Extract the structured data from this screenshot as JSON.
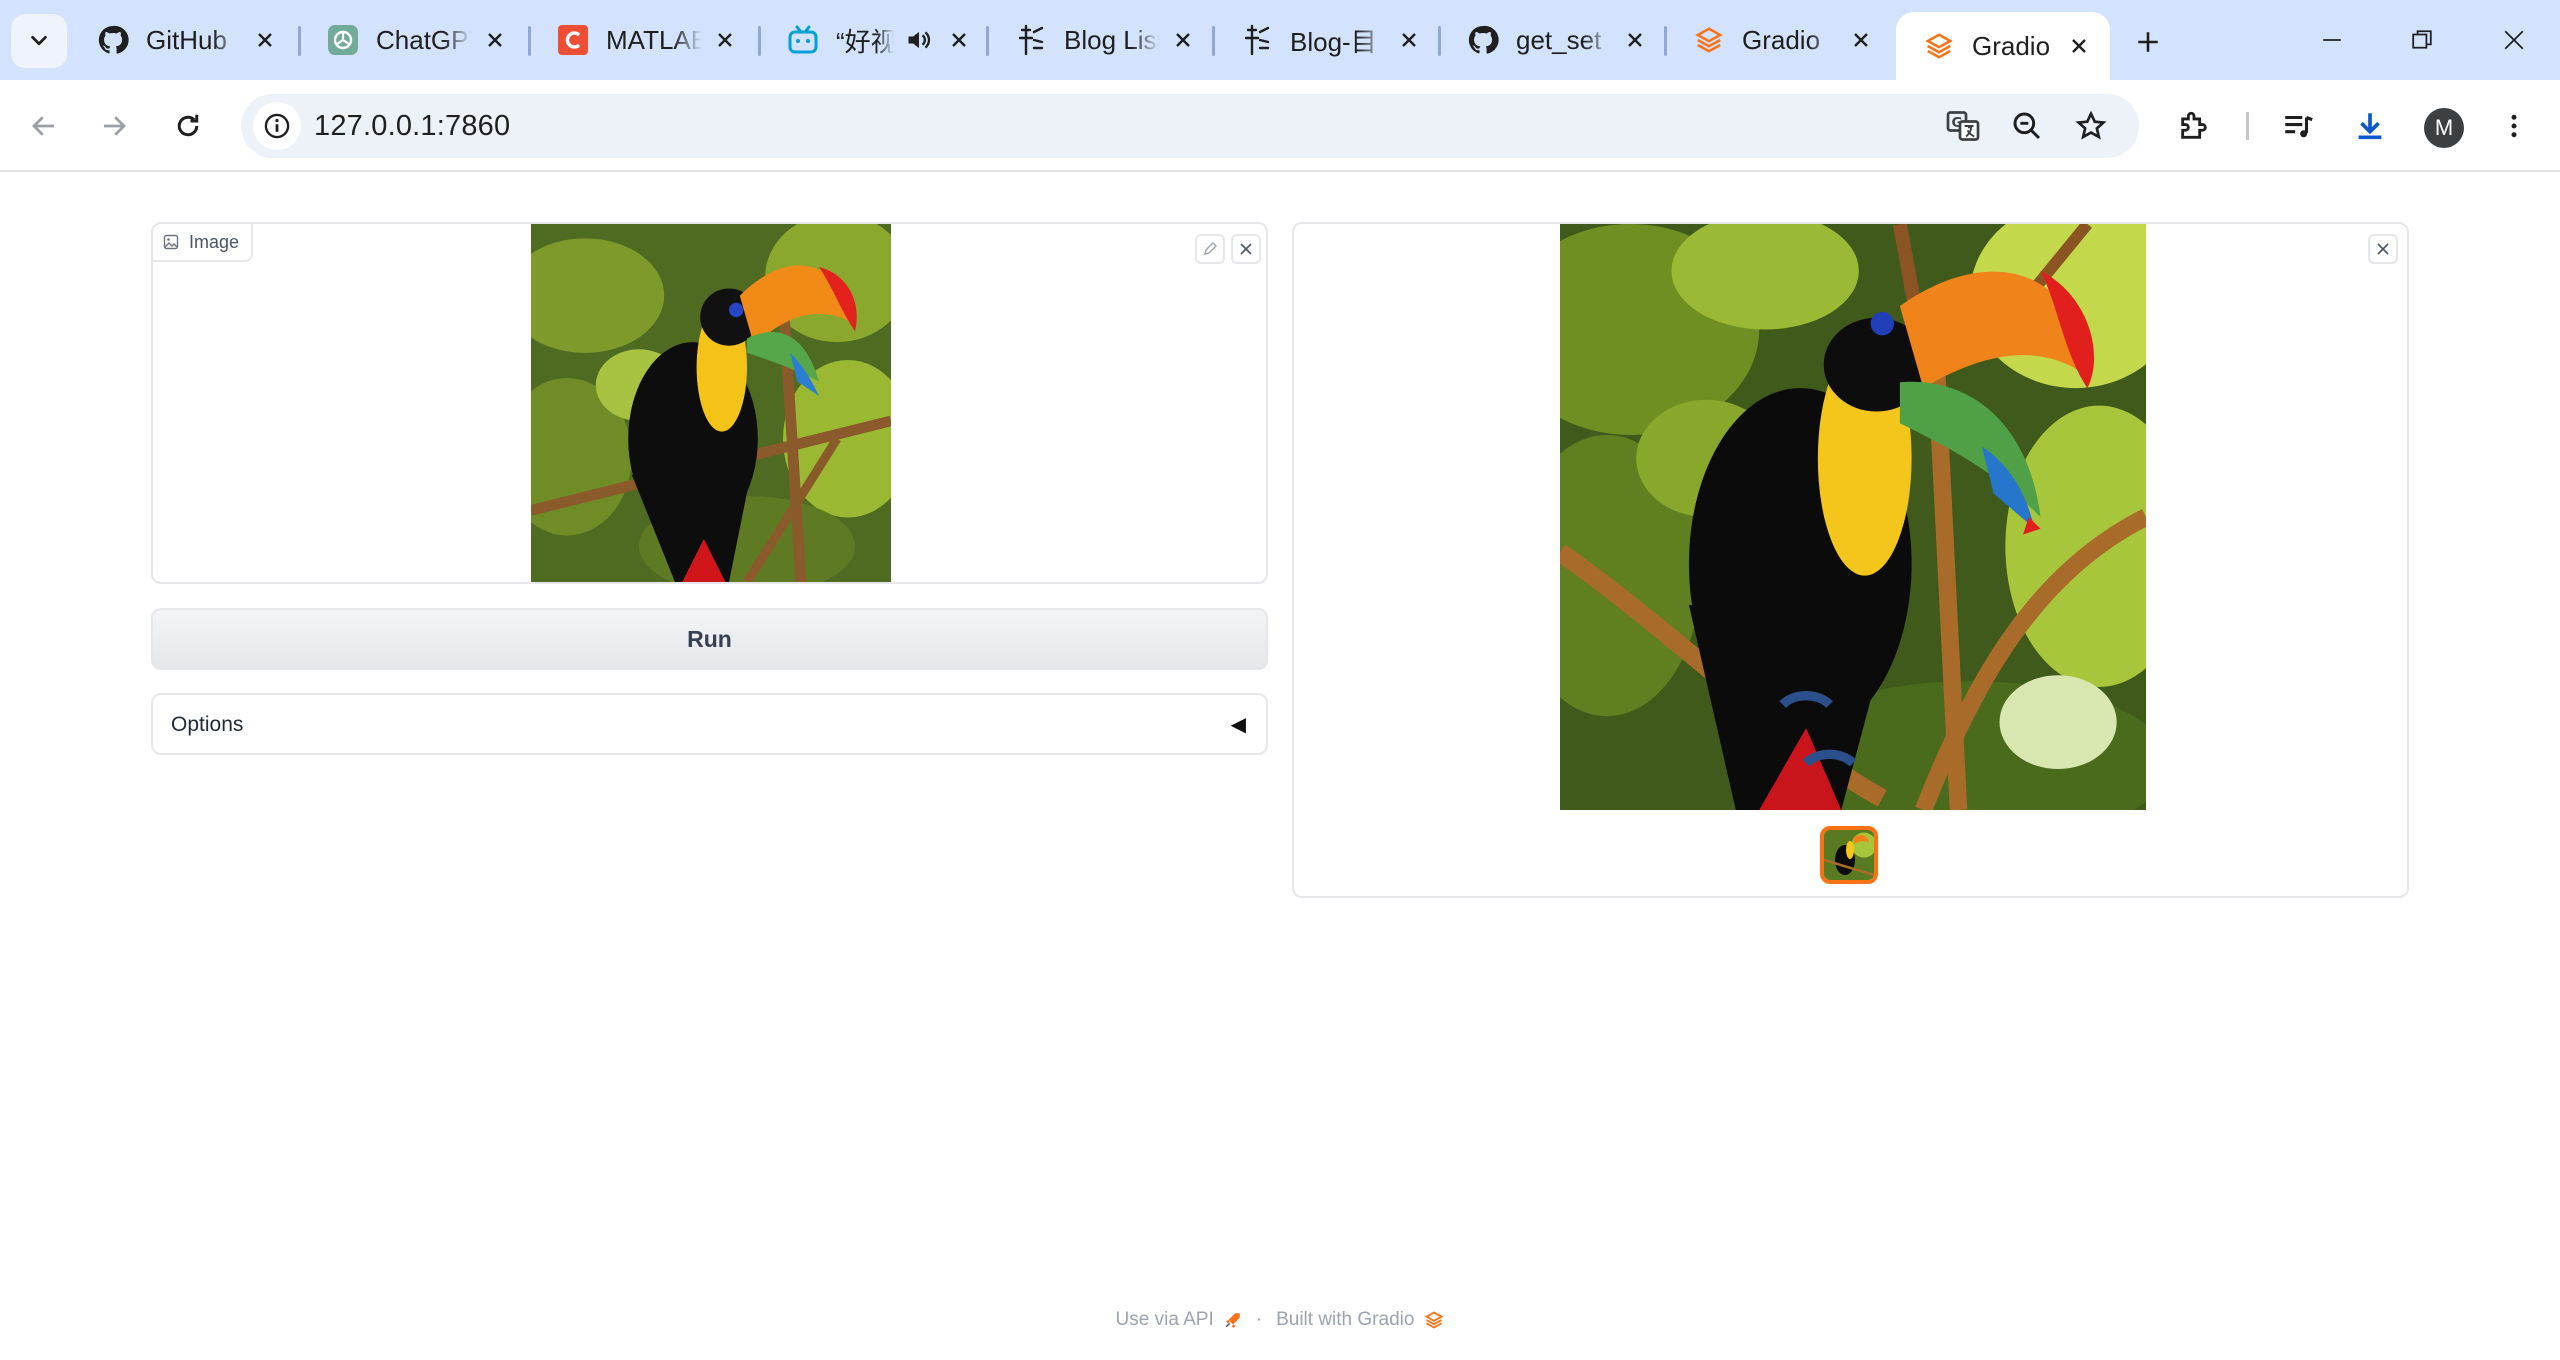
{
  "browser": {
    "tabs": [
      {
        "title": "GitHub",
        "icon": "github-icon"
      },
      {
        "title": "ChatGPT",
        "icon": "chatgpt-icon"
      },
      {
        "title": "MATLAB",
        "icon": "matlab-icon"
      },
      {
        "title": "“好视",
        "icon": "bilibili-icon",
        "audio": true
      },
      {
        "title": "Blog List",
        "icon": "blog-icon"
      },
      {
        "title": "Blog-目",
        "icon": "blog-icon"
      },
      {
        "title": "get_set",
        "icon": "github-icon"
      },
      {
        "title": "Gradio",
        "icon": "gradio-icon"
      },
      {
        "title": "Gradio",
        "icon": "gradio-icon",
        "active": true
      }
    ],
    "url": "127.0.0.1:7860",
    "profile_initial": "M"
  },
  "app": {
    "input_label": "Image",
    "run_label": "Run",
    "options_label": "Options",
    "options_caret": "◀"
  },
  "footer": {
    "api_text": "Use via API",
    "separator": "·",
    "built_text": "Built with Gradio"
  },
  "colors": {
    "accent": "#f97316",
    "tabstrip": "#d3e3fd"
  }
}
